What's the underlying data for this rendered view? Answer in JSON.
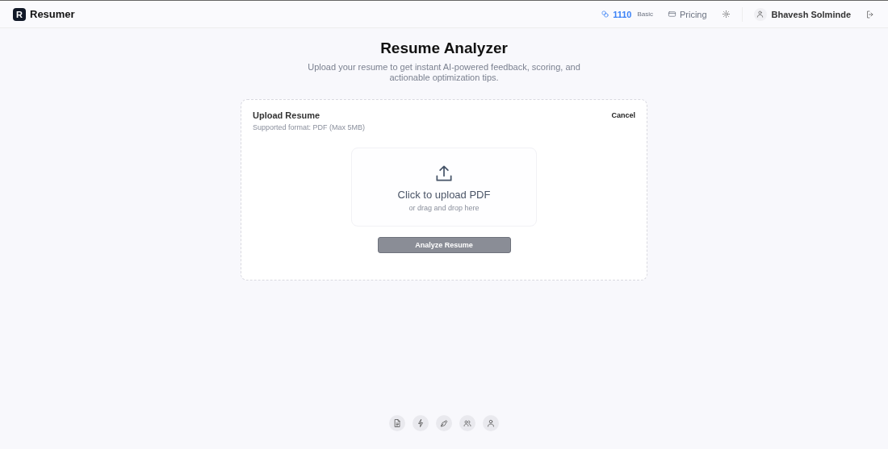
{
  "header": {
    "logo_letter": "R",
    "brand": "Resumer",
    "credits": "1110",
    "plan": "Basic",
    "pricing": "Pricing",
    "user": "Bhavesh Solminde"
  },
  "page": {
    "title": "Resume Analyzer",
    "subtitle": "Upload your resume to get instant AI-powered feedback, scoring, and actionable optimization tips."
  },
  "upload_card": {
    "title": "Upload Resume",
    "hint": "Supported format: PDF (Max 5MB)",
    "cancel": "Cancel",
    "dropzone_title": "Click to upload PDF",
    "dropzone_hint": "or drag and drop here",
    "analyze_button": {
      "label": "Analyze Resume",
      "disabled": true
    }
  },
  "dock": [
    {
      "kind": "document"
    },
    {
      "kind": "bolt"
    },
    {
      "kind": "pen"
    },
    {
      "kind": "users"
    },
    {
      "kind": "user"
    }
  ]
}
